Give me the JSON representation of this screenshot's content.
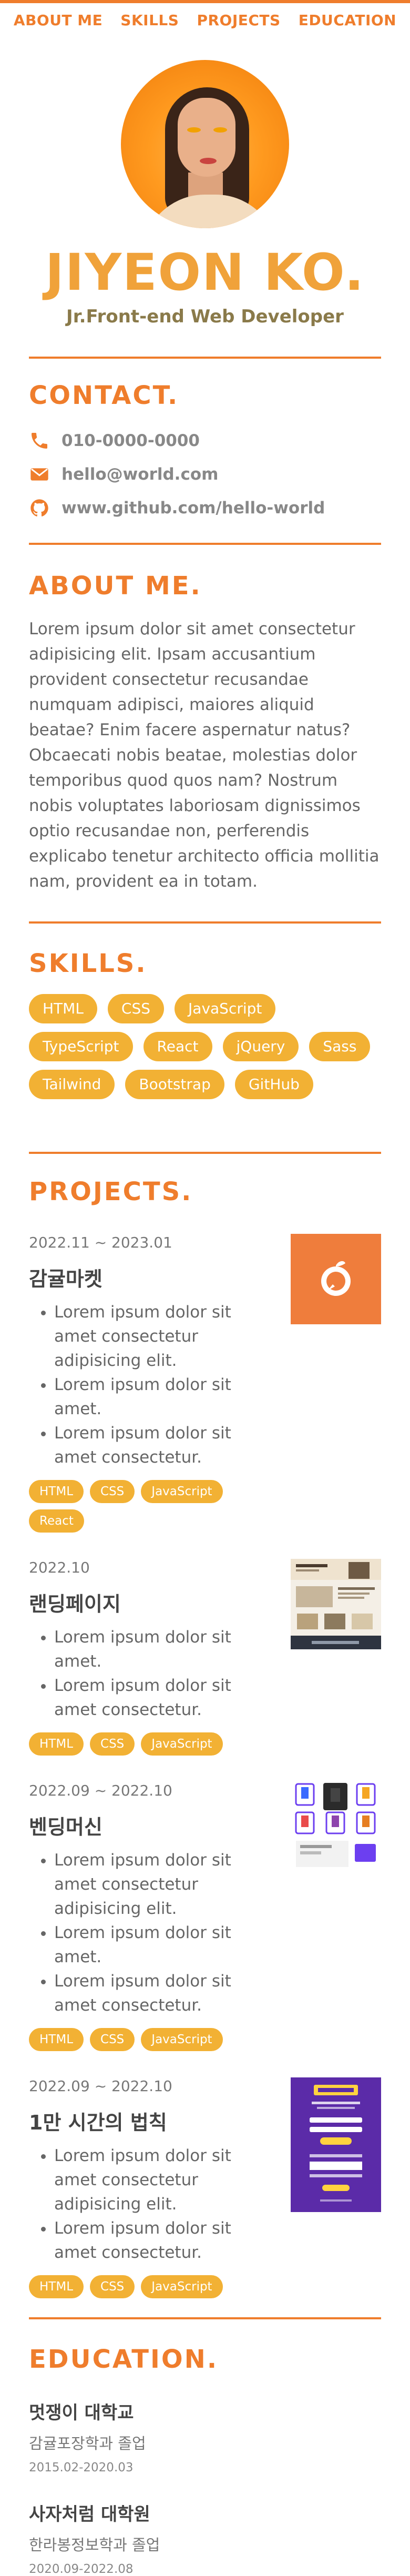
{
  "nav": {
    "items": [
      {
        "label": "ABOUT ME"
      },
      {
        "label": "SKILLS"
      },
      {
        "label": "PROJECTS"
      },
      {
        "label": "EDUCATION"
      }
    ]
  },
  "hero": {
    "name": "JIYEON KO.",
    "subtitle": "Jr.Front-end Web Developer"
  },
  "contact": {
    "title": "CONTACT.",
    "phone": "010-0000-0000",
    "email": "hello@world.com",
    "github": "www.github.com/hello-world",
    "icons": [
      "phone-icon",
      "mail-icon",
      "github-icon"
    ]
  },
  "about": {
    "title": "ABOUT ME.",
    "text": "Lorem ipsum dolor sit amet consectetur adipisicing elit. Ipsam accusantium provident consectetur recusandae numquam adipisci, maiores aliquid beatae? Enim facere aspernatur natus? Obcaecati nobis beatae, molestias dolor temporibus quod quos nam? Nostrum nobis voluptates laboriosam dignissimos optio recusandae non, perferendis explicabo tenetur architecto officia mollitia nam, provident ea in totam."
  },
  "skills": {
    "title": "SKILLS.",
    "items": [
      "HTML",
      "CSS",
      "JavaScript",
      "TypeScript",
      "React",
      "jQuery",
      "Sass",
      "Tailwind",
      "Bootstrap",
      "GitHub"
    ]
  },
  "projects": {
    "title": "PROJECTS.",
    "items": [
      {
        "date": "2022.11 ~ 2023.01",
        "title": "감귤마켓",
        "bullets": [
          "Lorem ipsum dolor sit amet consectetur adipisicing elit.",
          "Lorem ipsum dolor sit amet.",
          "Lorem ipsum dolor sit amet consectetur."
        ],
        "tags": [
          "HTML",
          "CSS",
          "JavaScript",
          "React"
        ]
      },
      {
        "date": "2022.10",
        "title": "랜딩페이지",
        "bullets": [
          "Lorem ipsum dolor sit amet.",
          "Lorem ipsum dolor sit amet consectetur."
        ],
        "tags": [
          "HTML",
          "CSS",
          "JavaScript"
        ]
      },
      {
        "date": "2022.09 ~ 2022.10",
        "title": "벤딩머신",
        "bullets": [
          "Lorem ipsum dolor sit amet consectetur adipisicing elit.",
          "Lorem ipsum dolor sit amet.",
          "Lorem ipsum dolor sit amet consectetur."
        ],
        "tags": [
          "HTML",
          "CSS",
          "JavaScript"
        ]
      },
      {
        "date": "2022.09 ~ 2022.10",
        "title": "1만 시간의 법칙",
        "bullets": [
          "Lorem ipsum dolor sit amet consectetur adipisicing elit.",
          "Lorem ipsum dolor sit amet consectetur."
        ],
        "tags": [
          "HTML",
          "CSS",
          "JavaScript"
        ]
      }
    ]
  },
  "education": {
    "title": "EDUCATION.",
    "items": [
      {
        "school": "멋쟁이 대학교",
        "major": "감귤포장학과 졸업",
        "date": "2015.02-2020.03"
      },
      {
        "school": "사자처럼 대학원",
        "major": "한라봉정보학과 졸업",
        "date": "2020.09-2022.08"
      }
    ]
  },
  "colors": {
    "accent": "#ef7d2c",
    "tag": "#f2b134",
    "name": "#f0a23a",
    "purple": "#5b2ba8"
  }
}
